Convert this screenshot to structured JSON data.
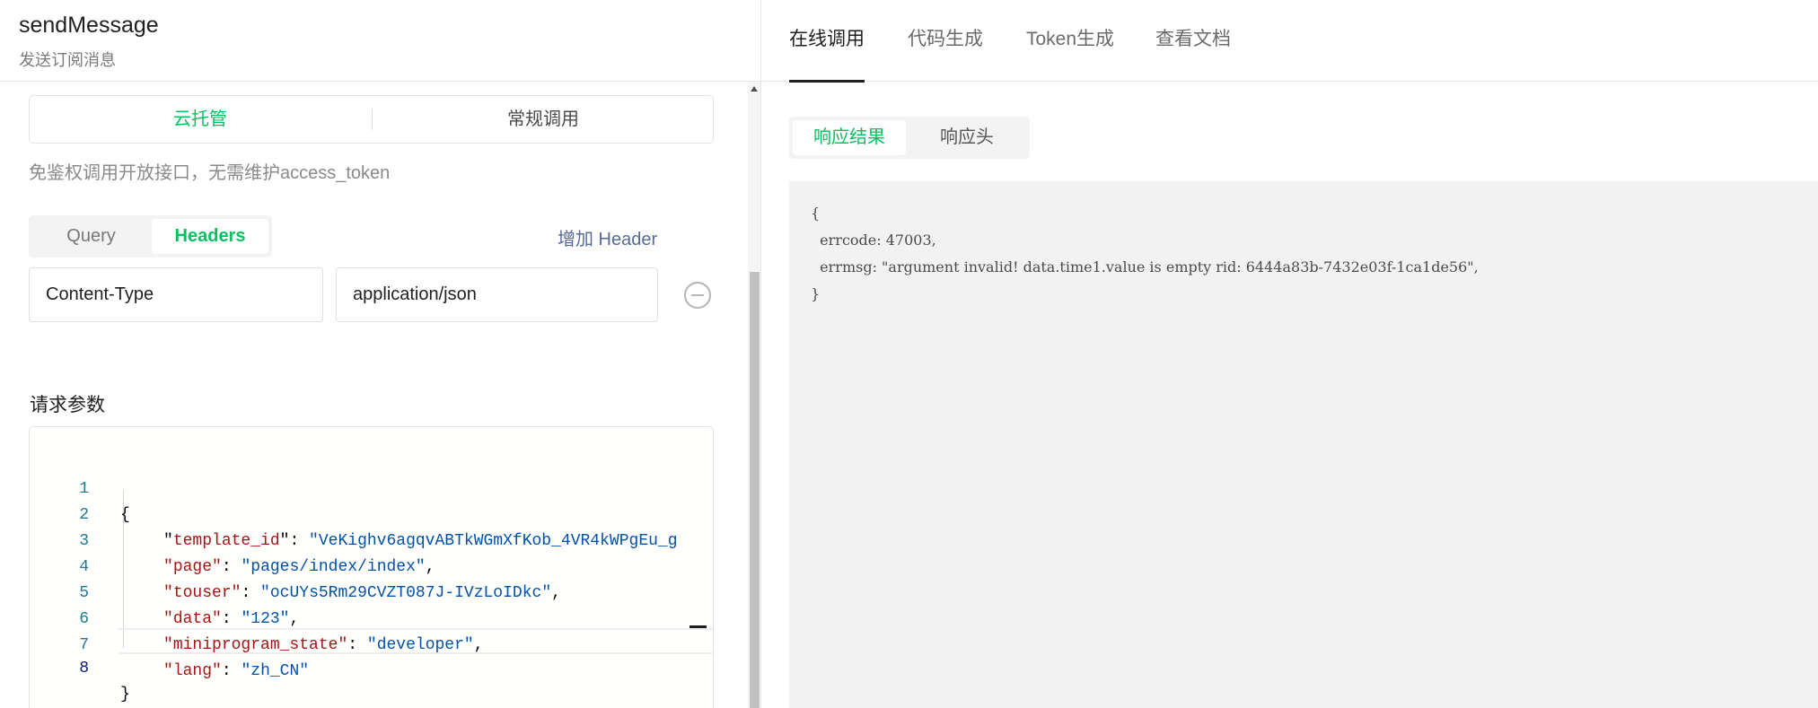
{
  "api": {
    "name": "sendMessage",
    "description": "发送订阅消息"
  },
  "mode_switch": {
    "options": [
      "云托管",
      "常规调用"
    ],
    "active": "云托管",
    "hint": "免鉴权调用开放接口，无需维护access_token"
  },
  "param_tabs": {
    "items": [
      "Query",
      "Headers"
    ],
    "active": "Headers",
    "add_header_label": "增加 Header"
  },
  "headers": [
    {
      "key": "Content-Type",
      "value": "application/json"
    }
  ],
  "request_params": {
    "label": "请求参数",
    "line_numbers": [
      "1",
      "2",
      "3",
      "4",
      "5",
      "6",
      "7",
      "8"
    ],
    "lines": [
      {
        "key": "template_id",
        "value": "VeKighv6agqvABTkWGmXfKob_4VR4kWPgEu_g"
      },
      {
        "key": "page",
        "value": "pages/index/index"
      },
      {
        "key": "touser",
        "value": "ocUYs5Rm29CVZT087J-IVzLoIDkc"
      },
      {
        "key": "data",
        "value": "123"
      },
      {
        "key": "miniprogram_state",
        "value": "developer"
      },
      {
        "key": "lang",
        "value": "zh_CN"
      }
    ],
    "open_brace": "{",
    "close_brace": "}"
  },
  "top_tabs": {
    "items": [
      "在线调用",
      "代码生成",
      "Token生成",
      "查看文档"
    ],
    "active": "在线调用"
  },
  "response_tabs": {
    "items": [
      "响应结果",
      "响应头"
    ],
    "active": "响应结果"
  },
  "response_body": {
    "lines": [
      "{",
      "  errcode: 47003,",
      "  errmsg: \"argument invalid! data.time1.value is empty rid: 6444a83b-7432e03f-1ca1de56\",",
      "}"
    ]
  },
  "colors": {
    "accent_green": "#07c160",
    "link_blue": "#576b95",
    "json_key": "#a31515",
    "json_string": "#0451a5",
    "line_number": "#237893"
  }
}
